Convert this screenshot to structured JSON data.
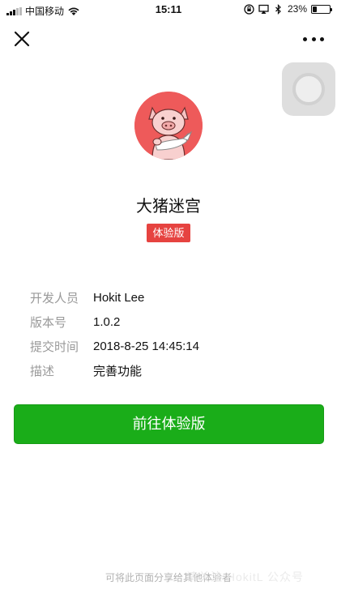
{
  "status_bar": {
    "carrier": "中国移动",
    "time": "15:11",
    "battery": "23%",
    "battery_level": 0.23
  },
  "nav": {
    "close_icon": "close-icon",
    "more_icon": "more-icon"
  },
  "app": {
    "name": "大猪迷宫",
    "badge": "体验版"
  },
  "info": [
    {
      "label": "开发人员",
      "value": "Hokit Lee"
    },
    {
      "label": "版本号",
      "value": "1.0.2"
    },
    {
      "label": "提交时间",
      "value": "2018-8-25 14:45:14"
    },
    {
      "label": "描述",
      "value": "完善功能"
    }
  ],
  "actions": {
    "open_trial": "前往体验版"
  },
  "footer": {
    "hint": "可将此页面分享给其他体验者",
    "watermark": "请关注 HokitL 公众号"
  },
  "colors": {
    "primary": "#1aad19",
    "badge": "#e64340",
    "avatar_bg": "#ee5a5a"
  }
}
